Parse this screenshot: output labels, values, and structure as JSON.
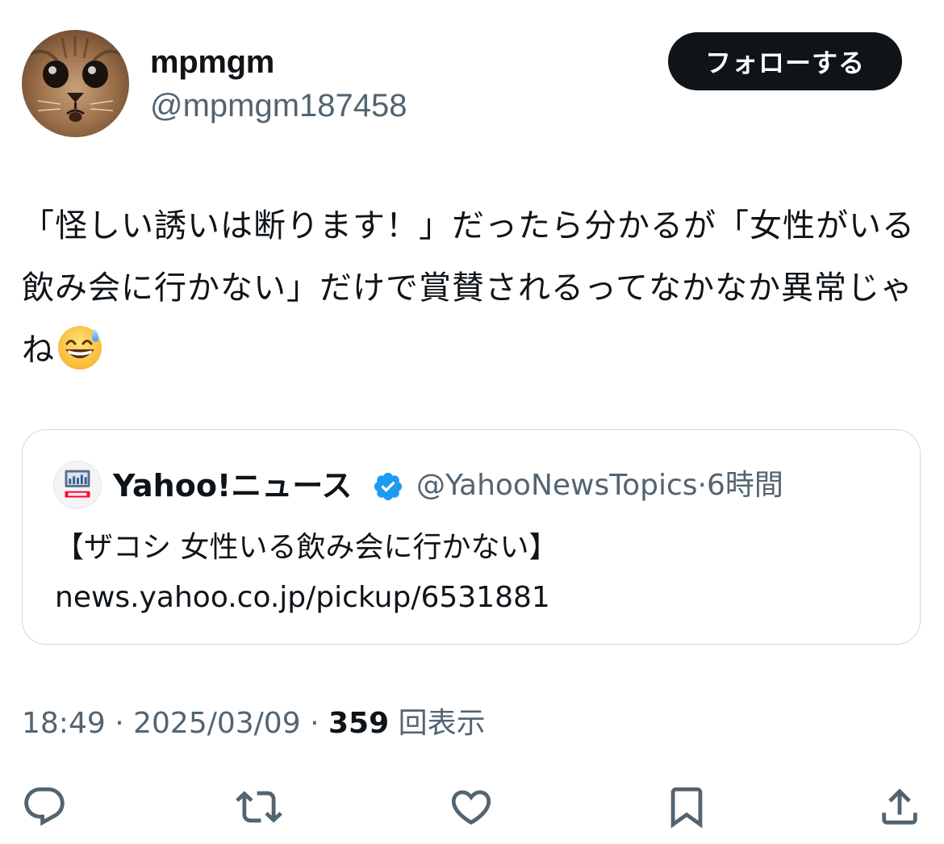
{
  "author": {
    "display_name": "mpmgm",
    "handle": "@mpmgm187458",
    "avatar_icon": "cat-face-avatar"
  },
  "follow_button": {
    "label": "フォローする"
  },
  "tweet": {
    "text": "「怪しい誘いは断ります！」だったら分かるが「女性がいる飲み会に行かない」だけで賞賛されるってなかなか異常じゃね",
    "emoji": "grinning-face-with-sweat-emoji"
  },
  "quote": {
    "avatar_icon": "yahoo-news-logo",
    "display_name": "Yahoo!ニュース",
    "verified_icon": "verified-badge-icon",
    "handle": "@YahooNewsTopics",
    "separator": "·",
    "time": "6時間",
    "title": "【ザコシ 女性いる飲み会に行かない】",
    "link": "news.yahoo.co.jp/pickup/6531881"
  },
  "meta": {
    "time": "18:49",
    "separator1": "·",
    "date": "2025/03/09",
    "separator2": "·",
    "views_count": "359",
    "views_label": "回表示"
  },
  "actions": [
    {
      "icon": "reply-icon"
    },
    {
      "icon": "retweet-icon"
    },
    {
      "icon": "like-icon"
    },
    {
      "icon": "bookmark-icon"
    },
    {
      "icon": "share-icon"
    }
  ],
  "colors": {
    "text": "#0f1419",
    "secondary": "#536471",
    "border": "#cfd9de",
    "verified": "#1d9bf0",
    "button_bg": "#0f1419"
  }
}
